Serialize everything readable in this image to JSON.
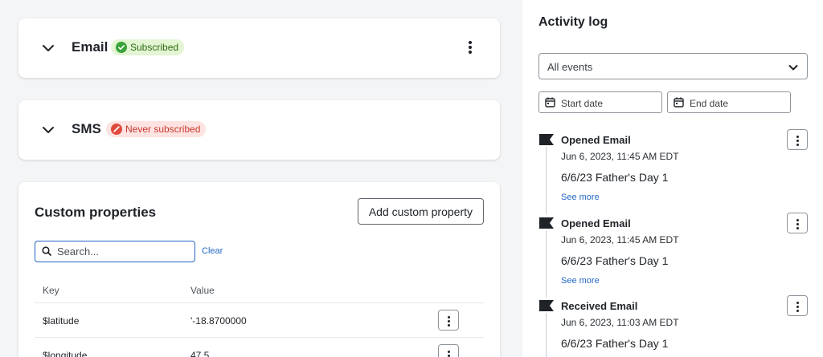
{
  "colors": {
    "accent_link": "#2567c4",
    "subscribed_bg": "#e3f5d3",
    "subscribed_text": "#2d6a12",
    "subscribed_icon": "#3aa33a",
    "never_bg": "#fde3e1",
    "never_text": "#c8372b",
    "never_icon": "#e0493b"
  },
  "channels": [
    {
      "title": "Email",
      "status": "Subscribed",
      "status_icon": "check-circle-icon"
    },
    {
      "title": "SMS",
      "status": "Never subscribed",
      "status_icon": "no-entry-icon"
    }
  ],
  "custom_properties": {
    "title": "Custom properties",
    "add_button": "Add custom property",
    "search_placeholder": "Search...",
    "search_value": "",
    "clear_label": "Clear",
    "columns": {
      "key": "Key",
      "value": "Value"
    },
    "rows": [
      {
        "key": "$latitude",
        "value": "'-18.8700000"
      },
      {
        "key": "$longitude",
        "value": "47.5"
      }
    ]
  },
  "activity_log": {
    "title": "Activity log",
    "filter_selected": "All events",
    "start_date_placeholder": "Start date",
    "end_date_placeholder": "End date",
    "events": [
      {
        "name": "Opened Email",
        "time": "Jun 6, 2023, 11:45 AM EDT",
        "campaign": "6/6/23 Father's Day 1",
        "more": "See more"
      },
      {
        "name": "Opened Email",
        "time": "Jun 6, 2023, 11:45 AM EDT",
        "campaign": "6/6/23 Father's Day 1",
        "more": "See more"
      },
      {
        "name": "Received Email",
        "time": "Jun 6, 2023, 11:03 AM EDT",
        "campaign": "6/6/23 Father's Day 1",
        "more": ""
      }
    ]
  }
}
